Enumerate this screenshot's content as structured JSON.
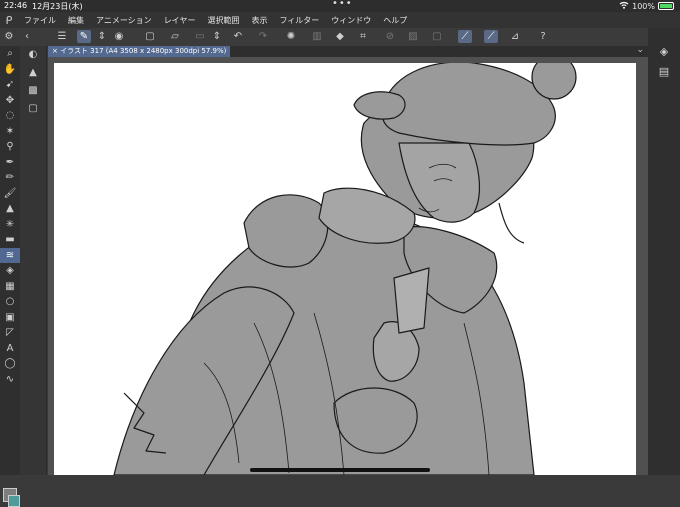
{
  "status": {
    "time": "22:46",
    "date": "12月23日(木)",
    "battery": "100%",
    "battery_level": 1.0
  },
  "menu": {
    "items": [
      "ファイル",
      "編集",
      "アニメーション",
      "レイヤー",
      "選択範囲",
      "表示",
      "フィルター",
      "ウィンドウ",
      "ヘルプ"
    ]
  },
  "tab": {
    "label": "イラスト 317 (A4 3508 x 2480px 300dpi 57.9%)"
  }
}
